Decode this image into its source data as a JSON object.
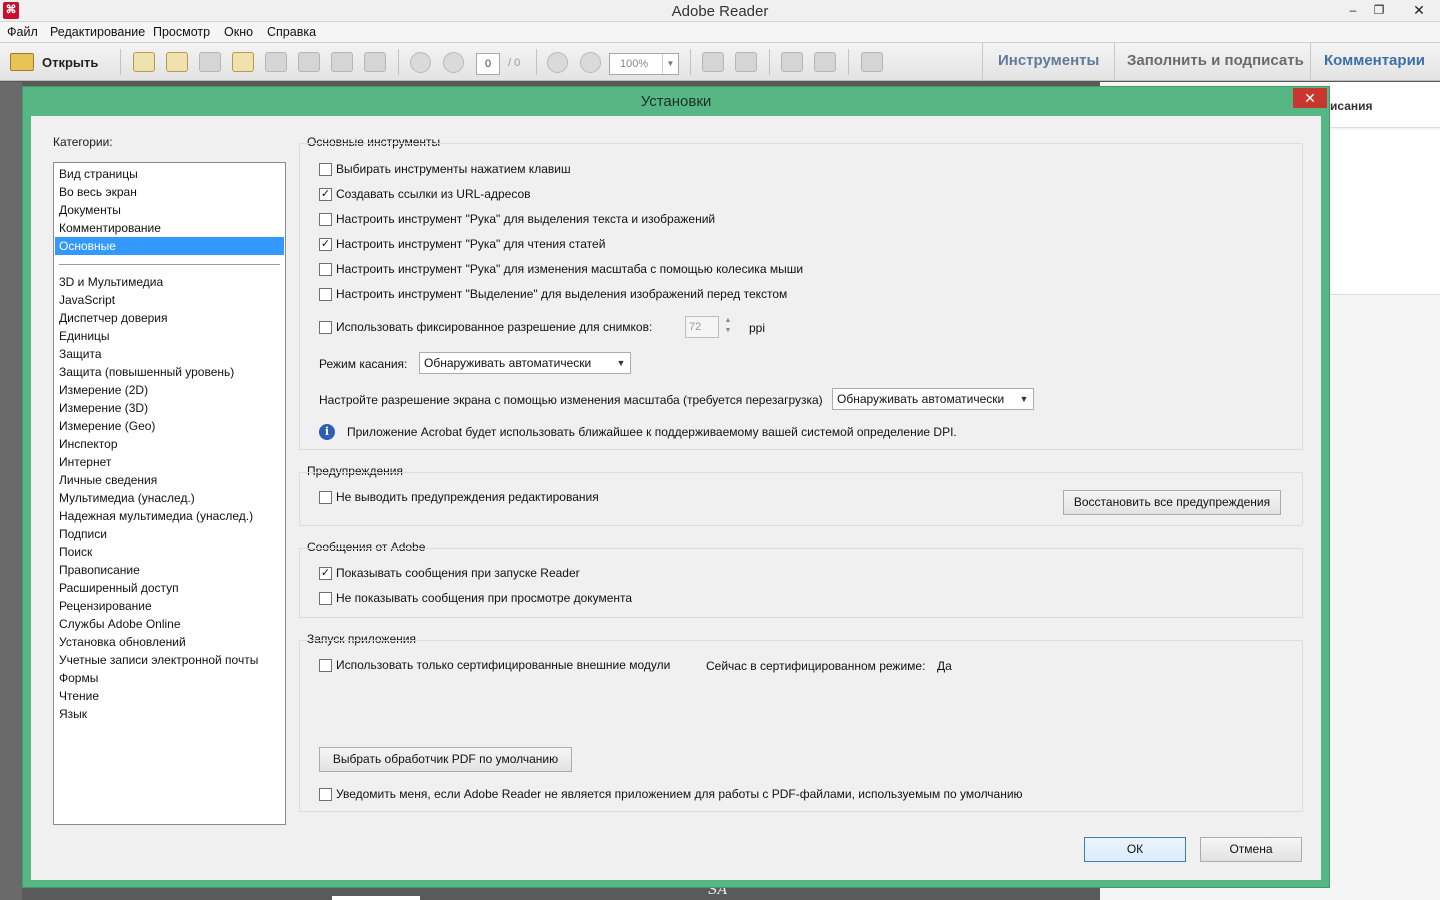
{
  "window": {
    "title": "Adobe Reader",
    "min": "‒",
    "max": "❐",
    "close": "✕"
  },
  "menu": [
    "Файл",
    "Редактирование",
    "Просмотр",
    "Окно",
    "Справка"
  ],
  "toolbar": {
    "open_label": "Открыть",
    "page_current": "0",
    "page_total": "/ 0",
    "zoom": "100%",
    "tabs": [
      "Инструменты",
      "Заполнить и подписать",
      "Комментарии"
    ]
  },
  "background": {
    "panel_text": "исания",
    "watermark": "SA"
  },
  "dialog": {
    "title": "Установки",
    "close": "✕",
    "categories_label": "Категории:",
    "categories_top": [
      "Вид страницы",
      "Во весь экран",
      "Документы",
      "Комментирование",
      "Основные"
    ],
    "selected_category": "Основные",
    "categories_bottom": [
      "3D и Мультимедиа",
      "JavaScript",
      "Диспетчер доверия",
      "Единицы",
      "Защита",
      "Защита (повышенный уровень)",
      "Измерение (2D)",
      "Измерение (3D)",
      "Измерение (Geo)",
      "Инспектор",
      "Интернет",
      "Личные сведения",
      "Мультимедиа (унаслед.)",
      "Надежная мультимедиа (унаслед.)",
      "Подписи",
      "Поиск",
      "Правописание",
      "Расширенный доступ",
      "Рецензирование",
      "Службы Adobe Online",
      "Установка обновлений",
      "Учетные записи электронной почты",
      "Формы",
      "Чтение",
      "Язык"
    ],
    "basic_tools": {
      "title": "Основные инструменты",
      "options": [
        {
          "label": "Выбирать инструменты нажатием клавиш",
          "checked": false
        },
        {
          "label": "Создавать ссылки из URL-адресов",
          "checked": true
        },
        {
          "label": "Настроить инструмент \"Рука\" для выделения текста и изображений",
          "checked": false
        },
        {
          "label": "Настроить инструмент \"Рука\" для чтения статей",
          "checked": true
        },
        {
          "label": "Настроить инструмент \"Рука\" для изменения масштаба с помощью колесика мыши",
          "checked": false
        },
        {
          "label": "Настроить инструмент \"Выделение\" для выделения изображений перед текстом",
          "checked": false
        }
      ],
      "fixed_res_label": "Использовать фиксированное разрешение для снимков:",
      "fixed_res_value": "72",
      "fixed_res_unit": "ppi",
      "touch_mode_label": "Режим касания:",
      "touch_mode_value": "Обнаруживать автоматически",
      "scale_label": "Настройте разрешение экрана с помощью изменения масштаба (требуется перезагрузка)",
      "scale_value": "Обнаруживать автоматически",
      "info_text": "Приложение Acrobat будет использовать ближайшее к поддерживаемому вашей системой определение DPI."
    },
    "warnings": {
      "title": "Предупреждения",
      "option": "Не выводить предупреждения редактирования",
      "restore_button": "Восстановить все предупреждения"
    },
    "messages": {
      "title": "Сообщения от Adobe",
      "options": [
        {
          "label": "Показывать сообщения при запуске Reader",
          "checked": true
        },
        {
          "label": "Не показывать сообщения при просмотре документа",
          "checked": false
        }
      ]
    },
    "startup": {
      "title": "Запуск приложения",
      "certified_label": "Использовать только сертифицированные внешние модули",
      "certified_mode_label": "Сейчас в сертифицированном режиме:",
      "certified_mode_value": "Да",
      "default_handler_button": "Выбрать обработчик PDF по умолчанию",
      "notify_label": "Уведомить меня, если Adobe Reader не является приложением для работы с PDF-файлами, используемым по умолчанию"
    },
    "ok": "ОК",
    "cancel": "Отмена"
  }
}
